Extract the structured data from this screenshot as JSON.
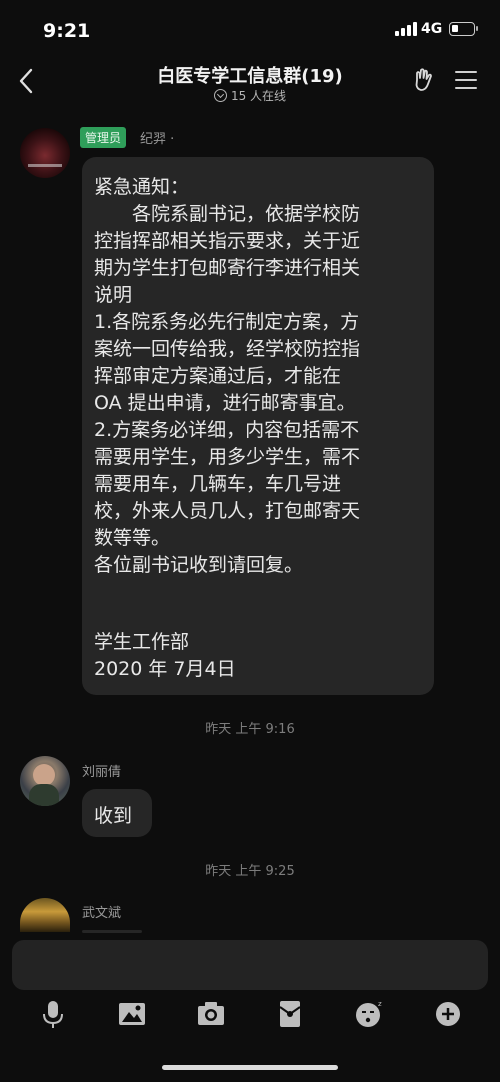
{
  "status_bar": {
    "time": "9:21",
    "network": "4G"
  },
  "header": {
    "title": "白医专学工信息群(19)",
    "subtitle": "15 人在线",
    "icons": [
      "chevron-left-icon",
      "hand-gesture-icon",
      "menu-icon"
    ]
  },
  "messages": [
    {
      "sender": "纪羿",
      "role_badge": "管理员",
      "sender_suffix": "·",
      "lines": [
        "紧急通知：",
        "　　各院系副书记，依据学校防",
        "控指挥部相关指示要求，关于近",
        "期为学生打包邮寄行李进行相关",
        "说明",
        "1.各院系务必先行制定方案，方",
        "案统一回传给我，经学校防控指",
        "挥部审定方案通过后，才能在",
        "OA 提出申请，进行邮寄事宜。",
        "2.方案务必详细，内容包括需不",
        "需要用学生，用多少学生，需不",
        "需要用车，几辆车，车几号进",
        "校，外来人员几人，打包邮寄天",
        "数等等。",
        "各位副书记收到请回复。",
        "",
        "",
        "学生工作部",
        "2020 年 7月4日"
      ]
    },
    {
      "timestamp": "昨天 上午 9:16"
    },
    {
      "sender": "刘丽倩",
      "text": "收到"
    },
    {
      "timestamp": "昨天 上午 9:25"
    },
    {
      "sender": "武文斌"
    }
  ],
  "toolbar": {
    "icons": [
      "microphone-icon",
      "image-icon",
      "camera-icon",
      "red-envelope-icon",
      "emoji-icon",
      "plus-icon"
    ]
  }
}
